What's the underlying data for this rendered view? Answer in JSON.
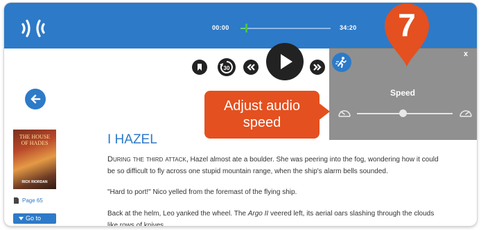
{
  "player": {
    "time_elapsed": "00:00",
    "time_total": "34:20",
    "progress_fraction": 0.06
  },
  "controls": {
    "skip_back_seconds": "30"
  },
  "speed_panel": {
    "close_label": "x",
    "title": "Speed",
    "speed_level_fraction": 0.48
  },
  "callout": {
    "text": "Adjust audio speed",
    "step_number": "7"
  },
  "book": {
    "cover_title": "THE HOUSE OF HADES",
    "cover_author": "RICK RIORDAN",
    "page_label": "Page 65",
    "goto_label": "Go to"
  },
  "chapter": {
    "title": "I HAZEL",
    "p1_lead": "During the third attack,",
    "p1_rest": " Hazel almost ate a boulder.  She was peering into the fog, wondering how it could be so difficult to fly across one stupid mountain  range, when the ship's alarm bells sounded.",
    "p2": "\"Hard to port!\" Nico yelled from the foremast of the flying ship.",
    "p3_a": "Back at the helm, Leo yanked the wheel. The ",
    "p3_em": "Argo II",
    "p3_b": " veered left, its aerial oars slashing through the clouds like rows of knives."
  },
  "colors": {
    "brand_blue": "#2d7ac8",
    "callout_orange": "#e4501f",
    "progress_green": "#48c14a",
    "panel_gray": "#787878"
  },
  "icons": [
    "app-logo-icon",
    "bookmark-icon",
    "rewind-30-icon",
    "rewind-icon",
    "play-icon",
    "fast-forward-icon",
    "speed-runner-icon",
    "close-icon",
    "slow-speed-gauge-icon",
    "fast-speed-gauge-icon",
    "back-arrow-icon",
    "page-icon",
    "chevron-down-icon",
    "step-marker-pin"
  ]
}
